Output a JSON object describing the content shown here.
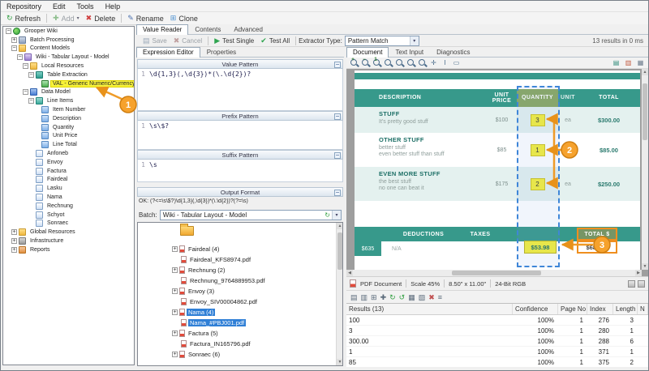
{
  "menu": {
    "items": [
      "Repository",
      "Edit",
      "Tools",
      "Help"
    ]
  },
  "toolbar": {
    "refresh": "Refresh",
    "add": "Add",
    "delete": "Delete",
    "rename": "Rename",
    "clone": "Clone"
  },
  "tree": {
    "items": [
      {
        "label": "Grooper Wiki",
        "level": 0,
        "expand": "minus",
        "icon": "globe"
      },
      {
        "label": "Batch Processing",
        "level": 1,
        "expand": "plus",
        "icon": "process"
      },
      {
        "label": "Content Models",
        "level": 1,
        "expand": "minus",
        "icon": "folder"
      },
      {
        "label": "Wiki - Tabular Layout - Model",
        "level": 2,
        "expand": "minus",
        "icon": "model"
      },
      {
        "label": "Local Resources",
        "level": 3,
        "expand": "minus",
        "icon": "folder"
      },
      {
        "label": "Table Extraction",
        "level": 4,
        "expand": "minus",
        "icon": "table"
      },
      {
        "label": "VAL - Generic Numeric/Currency",
        "level": 5,
        "expand": "none",
        "icon": "value",
        "highlight": true
      },
      {
        "label": "Data Model",
        "level": 3,
        "expand": "minus",
        "icon": "datamodel"
      },
      {
        "label": "Line Items",
        "level": 4,
        "expand": "minus",
        "icon": "lineitems"
      },
      {
        "label": "Item Number",
        "level": 5,
        "expand": "none",
        "icon": "field"
      },
      {
        "label": "Description",
        "level": 5,
        "expand": "none",
        "icon": "field"
      },
      {
        "label": "Quantity",
        "level": 5,
        "expand": "none",
        "icon": "field"
      },
      {
        "label": "Unit Price",
        "level": 5,
        "expand": "none",
        "icon": "field"
      },
      {
        "label": "Line Total",
        "level": 5,
        "expand": "none",
        "icon": "field"
      },
      {
        "label": "Anfoneb",
        "level": 4,
        "expand": "none",
        "icon": "doctype"
      },
      {
        "label": "Envoy",
        "level": 4,
        "expand": "none",
        "icon": "doctype"
      },
      {
        "label": "Factura",
        "level": 4,
        "expand": "none",
        "icon": "doctype"
      },
      {
        "label": "Fairdeal",
        "level": 4,
        "expand": "none",
        "icon": "doctype"
      },
      {
        "label": "Lasku",
        "level": 4,
        "expand": "none",
        "icon": "doctype"
      },
      {
        "label": "Nama",
        "level": 4,
        "expand": "none",
        "icon": "doctype"
      },
      {
        "label": "Rechnung",
        "level": 4,
        "expand": "none",
        "icon": "doctype"
      },
      {
        "label": "Schyot",
        "level": 4,
        "expand": "none",
        "icon": "doctype"
      },
      {
        "label": "Sonraec",
        "level": 4,
        "expand": "none",
        "icon": "doctype"
      },
      {
        "label": "Global Resources",
        "level": 1,
        "expand": "plus",
        "icon": "folder"
      },
      {
        "label": "Infrastructure",
        "level": 1,
        "expand": "plus",
        "icon": "infra"
      },
      {
        "label": "Reports",
        "level": 1,
        "expand": "plus",
        "icon": "reports"
      }
    ]
  },
  "value_reader": {
    "tabs": [
      "Value Reader",
      "Contents",
      "Advanced"
    ],
    "active_tab": "Value Reader",
    "save": "Save",
    "cancel": "Cancel",
    "test_single": "Test Single",
    "test_all": "Test All",
    "extractor_type_label": "Extractor Type:",
    "extractor_type": "Pattern Match",
    "results_summary": "13 results in 0 ms",
    "editor_tabs": [
      "Expression Editor",
      "Properties"
    ],
    "active_editor_tab": "Expression Editor",
    "sections": [
      {
        "title": "Value Pattern",
        "line": "1",
        "pattern": "\\d{1,3}(,\\d{3})*(\\.\\d{2})?"
      },
      {
        "title": "Prefix Pattern",
        "line": "1",
        "pattern": "\\s\\$?"
      },
      {
        "title": "Suffix Pattern",
        "line": "1",
        "pattern": "\\s"
      }
    ],
    "output_format": "Output Format",
    "status": "OK: (?<=\\s\\$?)\\d{1,3}(,\\d{3})*(\\.\\d{2})?(?=\\s)"
  },
  "batch": {
    "label": "Batch:",
    "selected": "Wiki - Tabular Layout - Model",
    "items": [
      {
        "name": "Fairdeal (4)",
        "file": "Fairdeal_KFS8974.pdf",
        "selected": false
      },
      {
        "name": "Rechnung (2)",
        "file": "Rechnung_9764889953.pdf",
        "selected": false
      },
      {
        "name": "Envoy (3)",
        "file": "Envoy_SIV00004862.pdf",
        "selected": false
      },
      {
        "name": "Nama (4)",
        "file": "Nama_#PBJ001.pdf",
        "selected": true
      },
      {
        "name": "Factura (5)",
        "file": "Factura_IN165796.pdf",
        "selected": false
      },
      {
        "name": "Sonraec (6)",
        "file": "",
        "selected": false
      }
    ]
  },
  "viewer": {
    "tabs": [
      "Document",
      "Text Input",
      "Diagnostics"
    ],
    "active_tab": "Document",
    "toolbar_icons": [
      "zoom-in",
      "zoom-out",
      "zoom-original",
      "zoom-fit-page",
      "zoom-fit-width",
      "zoom-region",
      "zoom-dynamic",
      "pan",
      "text-select",
      "region-select"
    ],
    "toolbar_icons_right": [
      "single-page",
      "facing-pages",
      "thumbnail-view"
    ],
    "status": {
      "doc": "PDF Document",
      "scale": "Scale 45%",
      "size": "8.50\" x 11.00\"",
      "color": "24-Bit RGB"
    }
  },
  "invoice": {
    "columns": [
      "DESCRIPTION",
      "UNIT PRICE",
      "QUANTITY",
      "UNIT",
      "TOTAL"
    ],
    "rows": [
      {
        "title": "STUFF",
        "lines": [
          "It's pretty good stuff"
        ],
        "price": "$100",
        "qty": "3",
        "unit": "ea",
        "total": "$300.00"
      },
      {
        "title": "OTHER STUFF",
        "lines": [
          "better stuff",
          "even better stuff than stuff"
        ],
        "price": "$85",
        "qty": "1",
        "unit": "ea",
        "total": "$85.00"
      },
      {
        "title": "EVEN MORE STUFF",
        "lines": [
          "the best stuff",
          "no one can beat it"
        ],
        "price": "$175",
        "qty": "2",
        "unit": "ea",
        "total": "$250.00"
      }
    ],
    "summary": {
      "subtotal": "$635",
      "deductions_label": "DEDUCTIONS",
      "deductions": "N/A",
      "taxes_label": "TAXES",
      "taxes": "$53.98",
      "total_label": "TOTAL $",
      "total": "$688.98"
    }
  },
  "results": {
    "toolbar_icons": [
      "export",
      "print",
      "copy",
      "add",
      "refresh",
      "undo",
      "grid",
      "layout",
      "delete",
      "menu"
    ],
    "columns": [
      "Results (13)",
      "Confidence",
      "Page No",
      "Index",
      "Length",
      "N"
    ],
    "rows": [
      [
        "100",
        "100%",
        "1",
        "276",
        "3"
      ],
      [
        "3",
        "100%",
        "1",
        "280",
        "1"
      ],
      [
        "300.00",
        "100%",
        "1",
        "288",
        "6"
      ],
      [
        "1",
        "100%",
        "1",
        "371",
        "1"
      ],
      [
        "85",
        "100%",
        "1",
        "375",
        "2"
      ]
    ]
  },
  "callouts": {
    "one": "1",
    "two": "2",
    "three": "3"
  },
  "colors": {
    "teal": "#37998b",
    "teal_light": "#e4f1ef",
    "highlight_yellow": "#f4ef3a",
    "callout_orange": "#f5a02a",
    "selection_blue": "#2f7fd6",
    "column_select_blue": "#3f86d8"
  }
}
